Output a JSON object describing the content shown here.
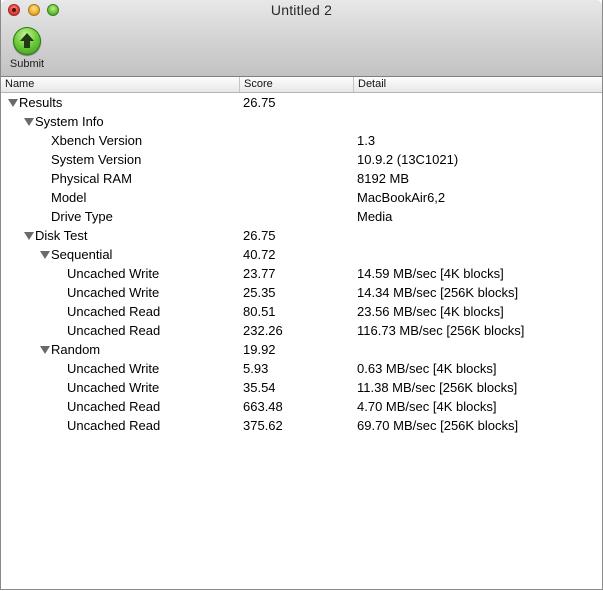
{
  "window": {
    "title": "Untitled 2"
  },
  "toolbar": {
    "submit_label": "Submit",
    "submit_icon": "green-up-arrow-icon"
  },
  "columns": {
    "name": "Name",
    "score": "Score",
    "detail": "Detail"
  },
  "rows": [
    {
      "name": "Results",
      "score": "26.75",
      "detail": "",
      "level": 0,
      "expandable": true
    },
    {
      "name": "System Info",
      "score": "",
      "detail": "",
      "level": 1,
      "expandable": true
    },
    {
      "name": "Xbench Version",
      "score": "",
      "detail": "1.3",
      "level": 2,
      "expandable": false
    },
    {
      "name": "System Version",
      "score": "",
      "detail": "10.9.2 (13C1021)",
      "level": 2,
      "expandable": false
    },
    {
      "name": "Physical RAM",
      "score": "",
      "detail": "8192 MB",
      "level": 2,
      "expandable": false
    },
    {
      "name": "Model",
      "score": "",
      "detail": "MacBookAir6,2",
      "level": 2,
      "expandable": false
    },
    {
      "name": "Drive Type",
      "score": "",
      "detail": "Media",
      "level": 2,
      "expandable": false
    },
    {
      "name": "Disk Test",
      "score": "26.75",
      "detail": "",
      "level": 1,
      "expandable": true
    },
    {
      "name": "Sequential",
      "score": "40.72",
      "detail": "",
      "level": 2,
      "expandable": true
    },
    {
      "name": "Uncached Write",
      "score": "23.77",
      "detail": "14.59 MB/sec [4K blocks]",
      "level": 3,
      "expandable": false
    },
    {
      "name": "Uncached Write",
      "score": "25.35",
      "detail": "14.34 MB/sec [256K blocks]",
      "level": 3,
      "expandable": false
    },
    {
      "name": "Uncached Read",
      "score": "80.51",
      "detail": "23.56 MB/sec [4K blocks]",
      "level": 3,
      "expandable": false
    },
    {
      "name": "Uncached Read",
      "score": "232.26",
      "detail": "116.73 MB/sec [256K blocks]",
      "level": 3,
      "expandable": false
    },
    {
      "name": "Random",
      "score": "19.92",
      "detail": "",
      "level": 2,
      "expandable": true
    },
    {
      "name": "Uncached Write",
      "score": "5.93",
      "detail": "0.63 MB/sec [4K blocks]",
      "level": 3,
      "expandable": false
    },
    {
      "name": "Uncached Write",
      "score": "35.54",
      "detail": "11.38 MB/sec [256K blocks]",
      "level": 3,
      "expandable": false
    },
    {
      "name": "Uncached Read",
      "score": "663.48",
      "detail": "4.70 MB/sec [4K blocks]",
      "level": 3,
      "expandable": false
    },
    {
      "name": "Uncached Read",
      "score": "375.62",
      "detail": "69.70 MB/sec [256K blocks]",
      "level": 3,
      "expandable": false
    }
  ]
}
